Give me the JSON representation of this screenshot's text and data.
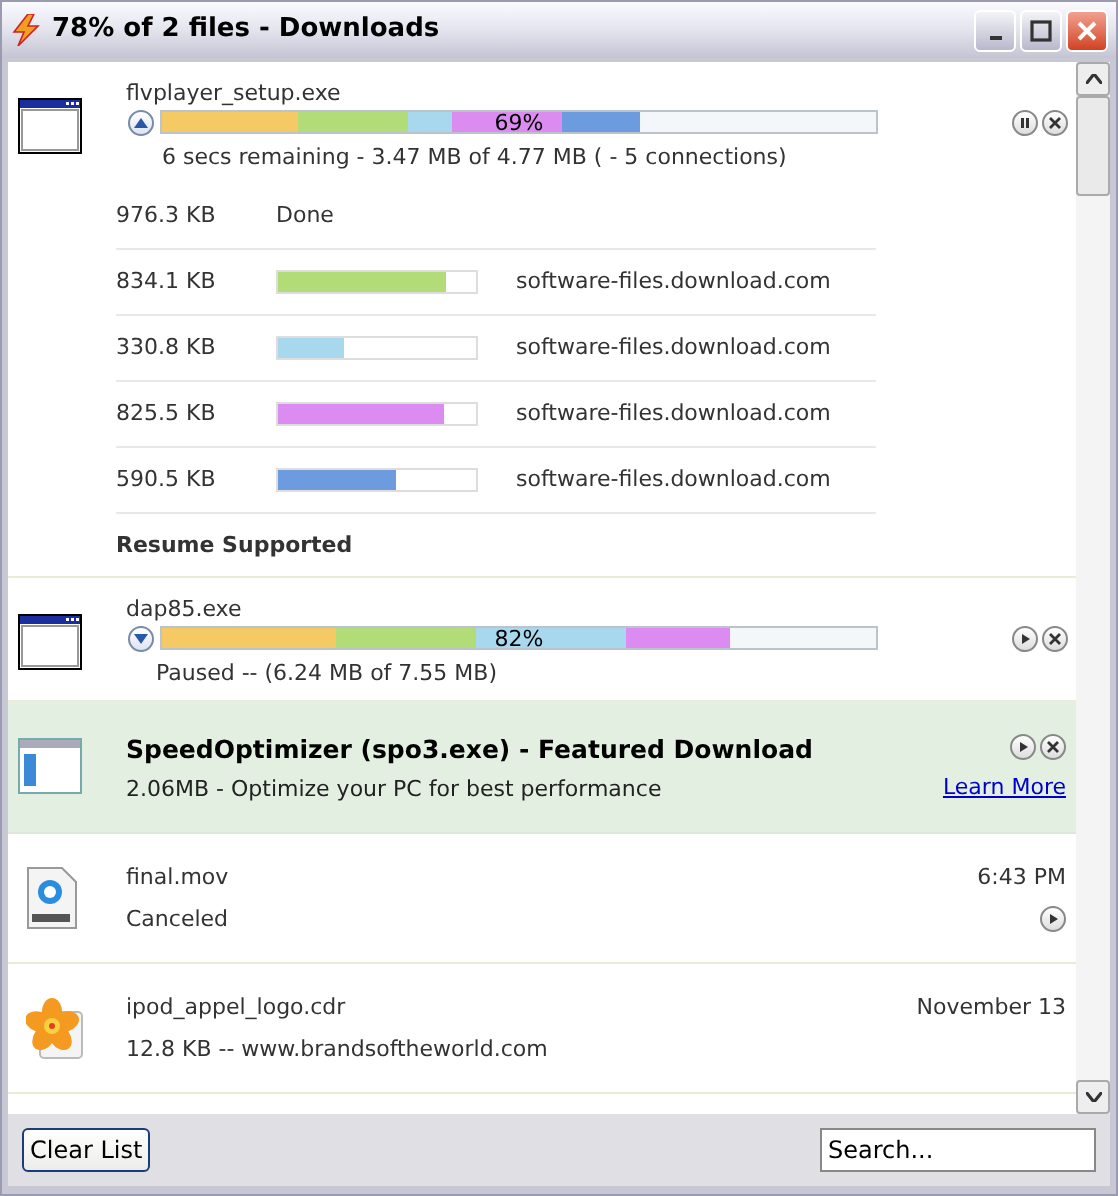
{
  "window": {
    "title": "78% of 2 files - Downloads"
  },
  "downloads": [
    {
      "kind": "active",
      "name": "flvplayer_setup.exe",
      "expanded": true,
      "paused": false,
      "percent": "69%",
      "status": "6 secs remaining - 3.47 MB of 4.77 MB ( - 5 connections)",
      "segments": [
        {
          "color": "#f5c964"
        },
        {
          "color": "#b2dc78"
        },
        {
          "color": "#a8d8ee"
        },
        {
          "color": "#dc8cf0"
        },
        {
          "color": "#6c9be0"
        }
      ],
      "connections": [
        {
          "kind": "done",
          "size": "976.3 KB",
          "status": "Done"
        },
        {
          "kind": "bar",
          "size": "834.1 KB",
          "color": "#b2dc78",
          "level": 0.85,
          "host": "software-files.download.com"
        },
        {
          "kind": "bar",
          "size": "330.8 KB",
          "color": "#a8d8ee",
          "level": 0.33,
          "host": "software-files.download.com"
        },
        {
          "kind": "bar",
          "size": "825.5 KB",
          "color": "#dc8cf0",
          "level": 0.84,
          "host": "software-files.download.com"
        },
        {
          "kind": "bar",
          "size": "590.5 KB",
          "color": "#6c9be0",
          "level": 0.6,
          "host": "software-files.download.com"
        }
      ],
      "note": "Resume Supported"
    },
    {
      "kind": "active",
      "name": "dap85.exe",
      "expanded": false,
      "paused": true,
      "percent": "82%",
      "status": "Paused -- (6.24 MB of 7.55 MB)",
      "segments": [
        {
          "color": "#f5c964"
        },
        {
          "color": "#b2dc78"
        },
        {
          "color": "#a8d8ee"
        },
        {
          "color": "#dc8cf0"
        }
      ]
    },
    {
      "kind": "featured",
      "name": "SpeedOptimizer (spo3.exe) - Featured Download",
      "status": "2.06MB - Optimize your PC for best performance",
      "link": "Learn More"
    },
    {
      "kind": "finished",
      "name": "final.mov",
      "status": "Canceled",
      "time": "6:43 PM",
      "retry": true
    },
    {
      "kind": "finished",
      "name": "ipod_appel_logo.cdr",
      "status": "12.8 KB -- www.brandsoftheworld.com",
      "time": "November 13",
      "retry": false
    }
  ],
  "footer": {
    "button": "Clear List",
    "search": {
      "placeholder": "Search..."
    }
  }
}
